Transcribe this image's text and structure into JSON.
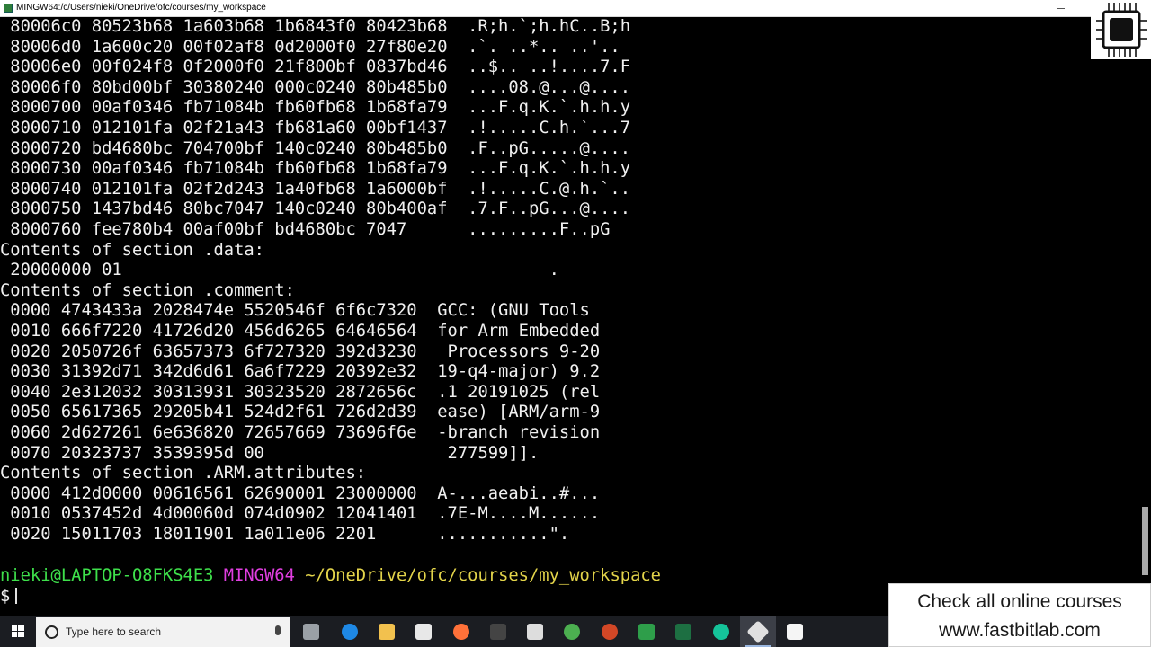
{
  "window": {
    "title": "MINGW64:/c/Users/nieki/OneDrive/ofc/courses/my_workspace"
  },
  "terminal": {
    "lines": [
      " 80006c0 80523b68 1a603b68 1b6843f0 80423b68  .R;h.`;h.hC..B;h",
      " 80006d0 1a600c20 00f02af8 0d2000f0 27f80e20  .`. ..*.. ..'..",
      " 80006e0 00f024f8 0f2000f0 21f800bf 0837bd46  ..$.. ..!....7.F",
      " 80006f0 80bd00bf 30380240 000c0240 80b485b0  ....08.@...@....",
      " 8000700 00af0346 fb71084b fb60fb68 1b68fa79  ...F.q.K.`.h.h.y",
      " 8000710 012101fa 02f21a43 fb681a60 00bf1437  .!.....C.h.`...7",
      " 8000720 bd4680bc 704700bf 140c0240 80b485b0  .F..pG.....@....",
      " 8000730 00af0346 fb71084b fb60fb68 1b68fa79  ...F.q.K.`.h.h.y",
      " 8000740 012101fa 02f2d243 1a40fb68 1a6000bf  .!.....C.@.h.`..",
      " 8000750 1437bd46 80bc7047 140c0240 80b400af  .7.F..pG...@....",
      " 8000760 fee780b4 00af00bf bd4680bc 7047      .........F..pG",
      "Contents of section .data:",
      " 20000000 01                                          .",
      "Contents of section .comment:",
      " 0000 4743433a 2028474e 5520546f 6f6c7320  GCC: (GNU Tools",
      " 0010 666f7220 41726d20 456d6265 64646564  for Arm Embedded",
      " 0020 2050726f 63657373 6f727320 392d3230   Processors 9-20",
      " 0030 31392d71 342d6d61 6a6f7229 20392e32  19-q4-major) 9.2",
      " 0040 2e312032 30313931 30323520 2872656c  .1 20191025 (rel",
      " 0050 65617365 29205b41 524d2f61 726d2d39  ease) [ARM/arm-9",
      " 0060 2d627261 6e636820 72657669 73696f6e  -branch revision",
      " 0070 20323737 3539395d 00                  277599]].",
      "Contents of section .ARM.attributes:",
      " 0000 412d0000 00616561 62690001 23000000  A-...aeabi..#...",
      " 0010 0537452d 4d00060d 074d0902 12041401  .7E-M....M......",
      " 0020 15011703 18011901 1a011e06 2201      ...........\"."
    ],
    "prompt": {
      "user_host": "nieki@LAPTOP-O8FKS4E3",
      "system": "MINGW64",
      "path": "~/OneDrive/ofc/courses/my_workspace",
      "symbol": "$"
    }
  },
  "watermark": {
    "line1": "Check all online courses",
    "line2": "www.fastbitlab.com"
  },
  "taskbar": {
    "search_placeholder": "Type here to search",
    "icons": [
      {
        "name": "task-view-icon",
        "color": "#9aa0a6"
      },
      {
        "name": "edge-icon",
        "color": "#1e88e5"
      },
      {
        "name": "file-explorer-icon",
        "color": "#f2c14e"
      },
      {
        "name": "store-icon",
        "color": "#e8e8e8"
      },
      {
        "name": "firefox-icon",
        "color": "#ff7139"
      },
      {
        "name": "notion-icon",
        "color": "#444444"
      },
      {
        "name": "mail-icon",
        "color": "#dddddd"
      },
      {
        "name": "chrome-icon",
        "color": "#4caf50"
      },
      {
        "name": "powerpoint-icon",
        "color": "#d24726"
      },
      {
        "name": "ide-icon",
        "color": "#2e9e4a"
      },
      {
        "name": "excel-icon",
        "color": "#1d6f42"
      },
      {
        "name": "grammarly-icon",
        "color": "#15c39a"
      },
      {
        "name": "git-icon",
        "color": "#e0e0e0"
      },
      {
        "name": "terminal-icon",
        "color": "#f5f5f5"
      }
    ]
  }
}
